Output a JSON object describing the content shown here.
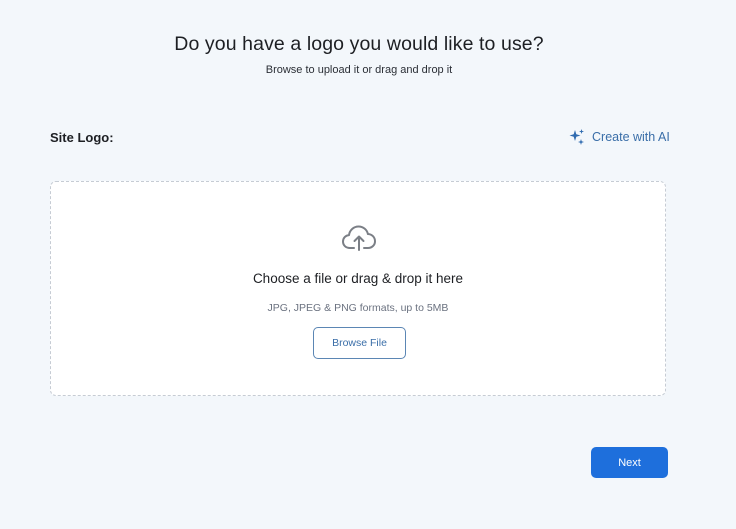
{
  "header": {
    "title": "Do you have a logo you would like to use?",
    "subtitle": "Browse to upload it or drag and drop it"
  },
  "site_logo": {
    "label": "Site Logo:",
    "create_ai_label": "Create with AI",
    "create_ai_icon": "sparkle-icon"
  },
  "dropzone": {
    "icon": "cloud-upload-icon",
    "title": "Choose a file or drag & drop it here",
    "formats": "JPG, JPEG & PNG formats, up to 5MB",
    "browse_label": "Browse File"
  },
  "footer": {
    "next_label": "Next"
  },
  "colors": {
    "background": "#f3f7fb",
    "accent": "#1e6fdc",
    "link": "#3a6ea8",
    "dashed_border": "#c6ccd4"
  }
}
